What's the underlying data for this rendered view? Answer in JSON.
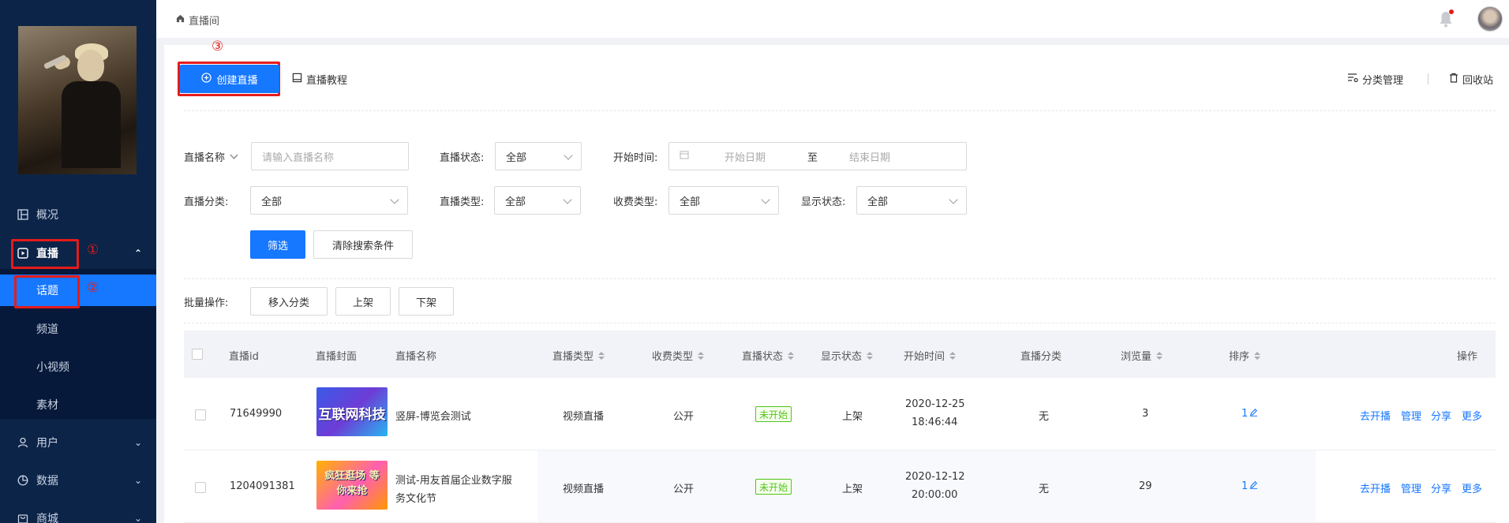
{
  "sidebar": {
    "items": [
      {
        "label": "概况"
      },
      {
        "label": "直播"
      },
      {
        "label": "用户"
      },
      {
        "label": "数据"
      },
      {
        "label": "商城"
      }
    ],
    "sub_items": [
      {
        "label": "话题"
      },
      {
        "label": "频道"
      },
      {
        "label": "小视频"
      },
      {
        "label": "素材"
      }
    ]
  },
  "annotations": {
    "c1": "①",
    "c2": "②",
    "c3": "③"
  },
  "topbar": {
    "breadcrumb": "直播间"
  },
  "toolbar": {
    "create_label": "创建直播",
    "tutorial_label": "直播教程",
    "category_label": "分类管理",
    "recycle_label": "回收站"
  },
  "filters": {
    "name_label": "直播名称",
    "name_placeholder": "请输入直播名称",
    "status_label": "直播状态:",
    "status_value": "全部",
    "time_label": "开始时间:",
    "start_placeholder": "开始日期",
    "to_label": "至",
    "end_placeholder": "结束日期",
    "category_label": "直播分类:",
    "category_value": "全部",
    "type_label": "直播类型:",
    "type_value": "全部",
    "fee_label": "收费类型:",
    "fee_value": "全部",
    "display_label": "显示状态:",
    "display_value": "全部",
    "filter_btn": "筛选",
    "clear_btn": "清除搜索条件"
  },
  "batch": {
    "label": "批量操作:",
    "move_btn": "移入分类",
    "up_btn": "上架",
    "down_btn": "下架"
  },
  "table": {
    "headers": [
      "直播id",
      "直播封面",
      "直播名称",
      "直播类型",
      "收费类型",
      "直播状态",
      "显示状态",
      "开始时间",
      "直播分类",
      "浏览量",
      "排序",
      "操作"
    ],
    "rows": [
      {
        "id": "71649990",
        "cover_text": "互联网科技",
        "name_line1": "竖屏-博览会测试",
        "name_line2": "",
        "type": "视频直播",
        "fee": "公开",
        "status": "未开始",
        "display": "上架",
        "date": "2020-12-25",
        "time": "18:46:44",
        "category": "无",
        "views": "3",
        "sort": "1",
        "actions": [
          "去开播",
          "管理",
          "分享",
          "更多"
        ]
      },
      {
        "id": "1204091381",
        "cover_text": "疯狂逛场 等你来抢",
        "name_line1": "测试-用友首届企业数字服",
        "name_line2": "务文化节",
        "type": "视频直播",
        "fee": "公开",
        "status": "未开始",
        "display": "上架",
        "date": "2020-12-12",
        "time": "20:00:00",
        "category": "无",
        "views": "29",
        "sort": "1",
        "actions": [
          "去开播",
          "管理",
          "分享",
          "更多"
        ]
      }
    ]
  },
  "colors": {
    "sidebar_bg": "#0c2448",
    "primary": "#1677ff",
    "annotation_red": "#e51b1b",
    "status_green": "#52c41a"
  }
}
